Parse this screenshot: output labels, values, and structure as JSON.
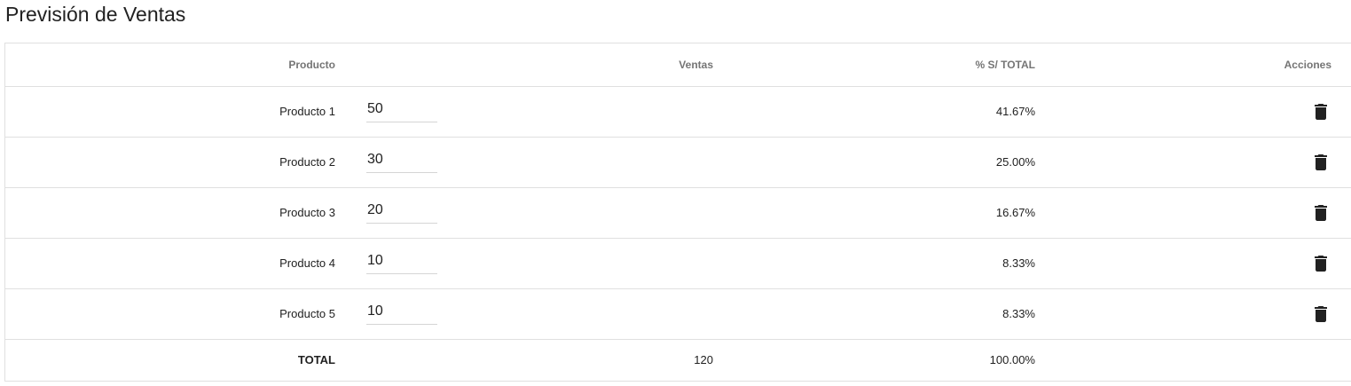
{
  "page": {
    "title": "Previsión de Ventas"
  },
  "table": {
    "headers": {
      "product": "Producto",
      "sales": "Ventas",
      "percent": "% S/ TOTAL",
      "actions": "Acciones"
    },
    "rows": [
      {
        "product": "Producto 1",
        "sales": "50",
        "percent": "41.67%",
        "action_icon": "trash-icon"
      },
      {
        "product": "Producto 2",
        "sales": "30",
        "percent": "25.00%",
        "action_icon": "trash-icon"
      },
      {
        "product": "Producto 3",
        "sales": "20",
        "percent": "16.67%",
        "action_icon": "trash-icon"
      },
      {
        "product": "Producto 4",
        "sales": "10",
        "percent": "8.33%",
        "action_icon": "trash-icon"
      },
      {
        "product": "Producto 5",
        "sales": "10",
        "percent": "8.33%",
        "action_icon": "trash-icon"
      }
    ],
    "total": {
      "label": "TOTAL",
      "sales": "120",
      "percent": "100.00%"
    }
  },
  "colors": {
    "border": "#e0e0e0",
    "header_text": "#757575",
    "body_text": "#212121",
    "icon": "#212121"
  }
}
